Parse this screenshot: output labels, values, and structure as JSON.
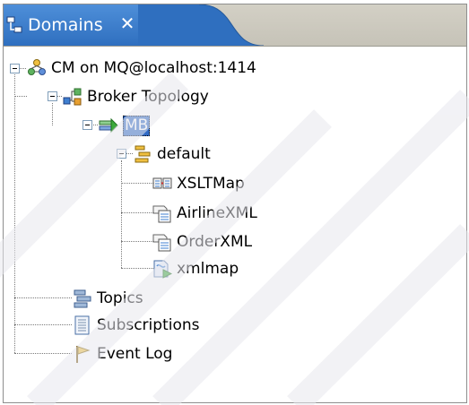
{
  "view": {
    "tab_title": "Domains",
    "close_glyph": "✕",
    "tab_icon": "domains-view-icon"
  },
  "tree": {
    "root": {
      "label": "CM on MQ@localhost:1414",
      "icon": "domain-connection-icon",
      "expanded": true
    },
    "topology": {
      "label": "Broker Topology",
      "icon": "broker-topology-icon",
      "expanded": true
    },
    "broker": {
      "label": "MB",
      "icon": "broker-icon",
      "expanded": true,
      "selected": true
    },
    "execution_group": {
      "label": "default",
      "icon": "execution-group-icon",
      "expanded": true
    },
    "deployed": [
      {
        "label": "XSLTMap",
        "icon": "message-flow-icon"
      },
      {
        "label": "AirlineXML",
        "icon": "message-set-icon"
      },
      {
        "label": "OrderXML",
        "icon": "message-set-icon"
      },
      {
        "label": "xmlmap",
        "icon": "mapping-file-icon"
      }
    ],
    "others": [
      {
        "label": "Topics",
        "icon": "topics-icon"
      },
      {
        "label": "Subscriptions",
        "icon": "subscriptions-icon"
      },
      {
        "label": "Event Log",
        "icon": "event-log-flag-icon"
      }
    ]
  },
  "colors": {
    "tab_active": "#3f7fcf",
    "selection": "#316ac5",
    "tree_lines": "#7a7a7a"
  }
}
